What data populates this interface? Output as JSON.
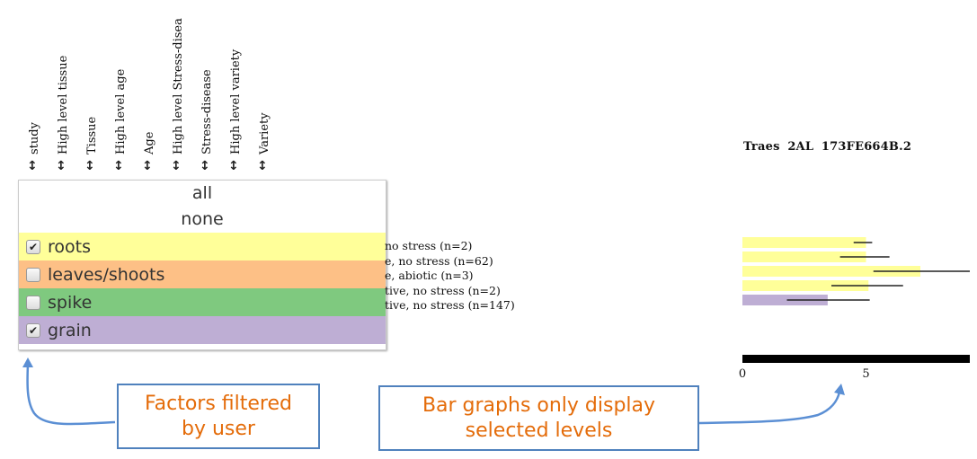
{
  "columns": [
    {
      "label": "study"
    },
    {
      "label": "High level tissue"
    },
    {
      "label": "Tissue"
    },
    {
      "label": "High level age"
    },
    {
      "label": "Age"
    },
    {
      "label": "High level Stress-disea"
    },
    {
      "label": "Stress-disease"
    },
    {
      "label": "High level variety"
    },
    {
      "label": "Variety"
    }
  ],
  "sort_icon": "↕",
  "filter_dropdown": {
    "all_label": "all",
    "none_label": "none",
    "items": [
      {
        "label": "roots",
        "checked": true,
        "color": "#FFFF99"
      },
      {
        "label": "leaves/shoots",
        "checked": false,
        "color": "#FDC086"
      },
      {
        "label": "spike",
        "checked": false,
        "color": "#7FC97F"
      },
      {
        "label": "grain",
        "checked": true,
        "color": "#BEAED4"
      }
    ],
    "check_glyph": "✔"
  },
  "row_labels": [
    "no stress (n=2)",
    "e, no stress (n=62)",
    "e, abiotic (n=3)",
    "tive, no stress (n=2)",
    "tive, no stress (n=147)"
  ],
  "gene_title": "Traes 2AL 173FE664B.2",
  "callouts": {
    "left": {
      "line1": "Factors filtered",
      "line2": "by user"
    },
    "right": {
      "line1": "Bar graphs only display",
      "line2": "selected levels"
    }
  },
  "colors": {
    "callout_border": "#4F81BD",
    "callout_text": "#E46C0A",
    "arrow": "#5B8FD4"
  },
  "chart_data": {
    "type": "bar",
    "orientation": "horizontal",
    "title": "Traes 2AL 173FE664B.2",
    "xlabel": "",
    "ylabel": "",
    "xlim": [
      0,
      9.2
    ],
    "xticks": [
      0,
      5
    ],
    "categories": [
      "no stress (n=2)",
      "e, no stress (n=62)",
      "e, abiotic (n=3)",
      "tive, no stress (n=2)",
      "tive, no stress (n=147)"
    ],
    "values": [
      5.0,
      5.0,
      7.2,
      5.1,
      3.45
    ],
    "error_low": [
      4.5,
      3.95,
      5.3,
      3.6,
      1.8
    ],
    "error_high": [
      5.25,
      5.95,
      9.2,
      6.5,
      5.15
    ],
    "bar_colors": [
      "#FFFF99",
      "#FFFF99",
      "#FFFF99",
      "#FFFF99",
      "#BEAED4"
    ],
    "groups": [
      "roots",
      "roots",
      "roots",
      "roots",
      "grain"
    ],
    "grid": false,
    "legend": "none"
  }
}
